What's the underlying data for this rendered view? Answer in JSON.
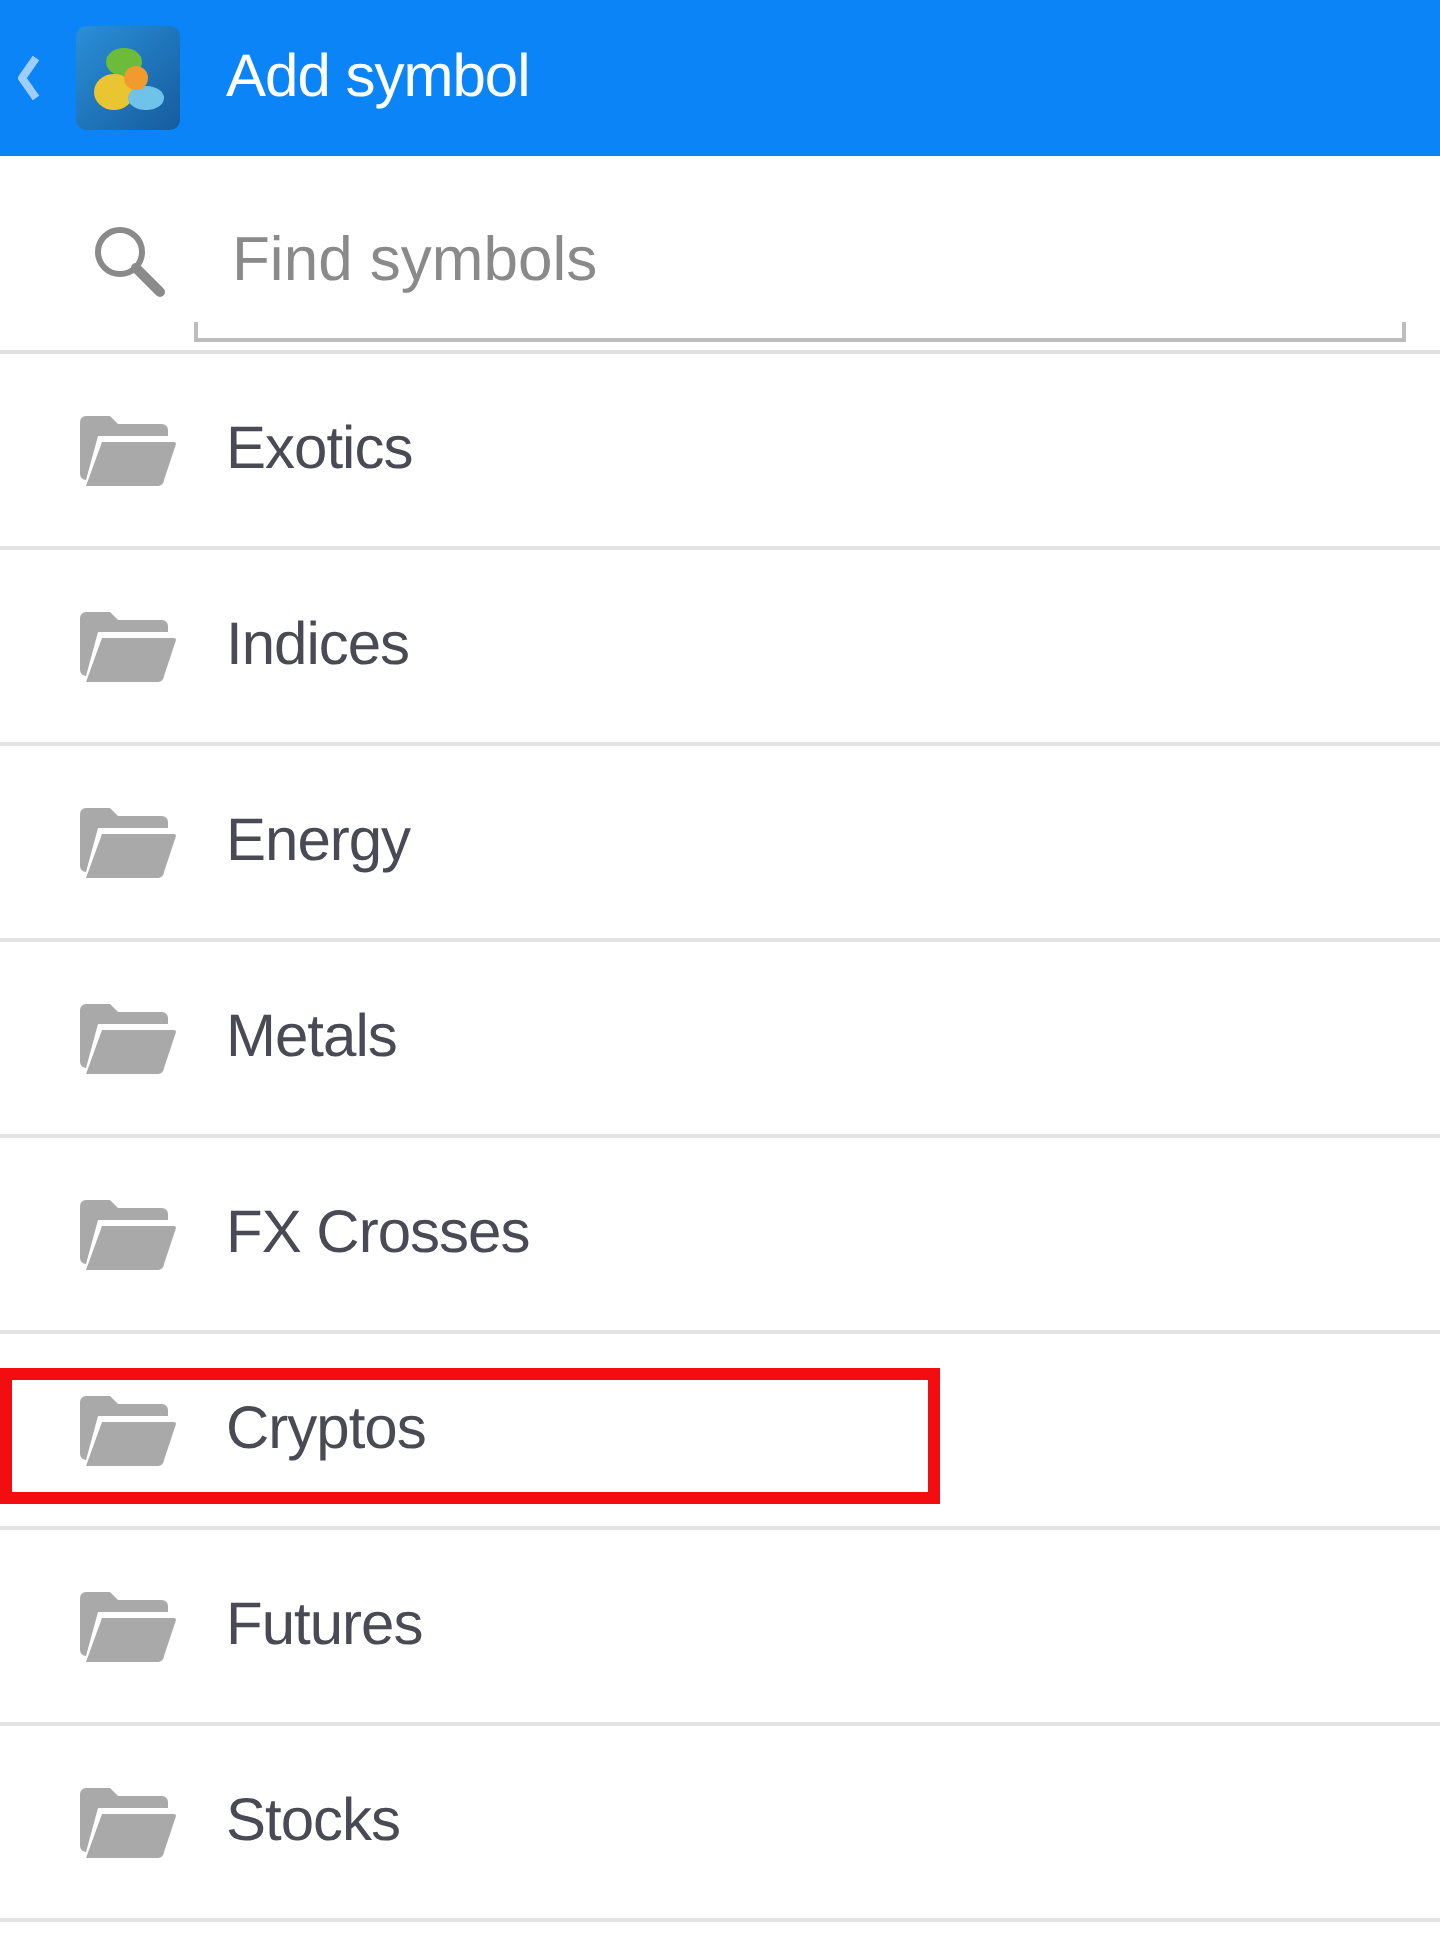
{
  "header": {
    "title": "Add symbol"
  },
  "search": {
    "placeholder": "Find symbols"
  },
  "categories": [
    {
      "label": "Exotics",
      "highlighted": false
    },
    {
      "label": "Indices",
      "highlighted": false
    },
    {
      "label": "Energy",
      "highlighted": false
    },
    {
      "label": "Metals",
      "highlighted": false
    },
    {
      "label": "FX Crosses",
      "highlighted": false
    },
    {
      "label": "Cryptos",
      "highlighted": true
    },
    {
      "label": "Futures",
      "highlighted": false
    },
    {
      "label": "Stocks",
      "highlighted": false
    }
  ]
}
